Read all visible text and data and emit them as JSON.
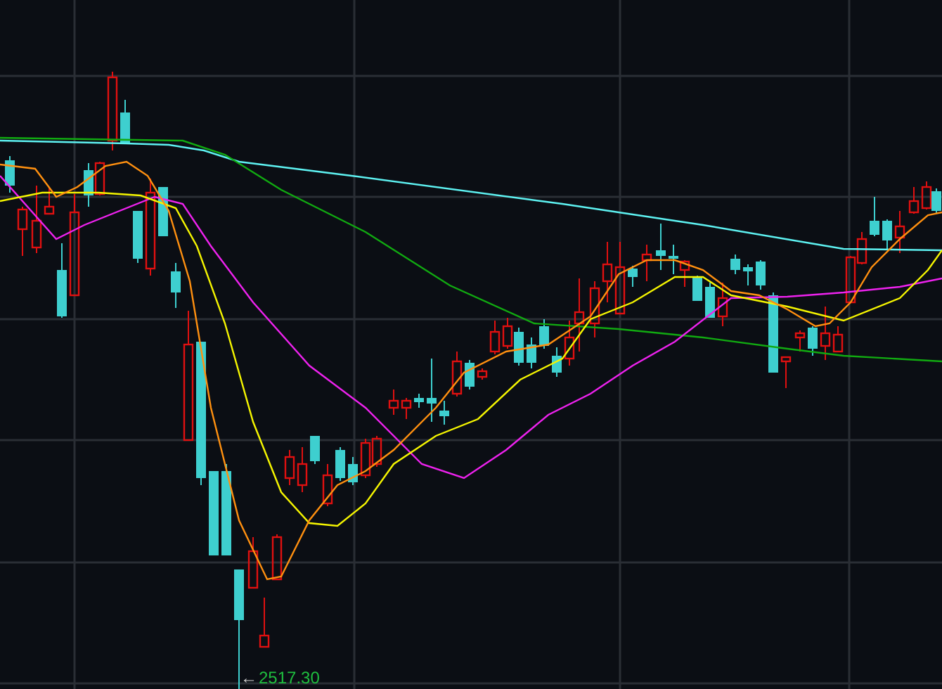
{
  "chart": {
    "low_marker": {
      "arrow": "←",
      "label": "2517.30"
    }
  }
}
